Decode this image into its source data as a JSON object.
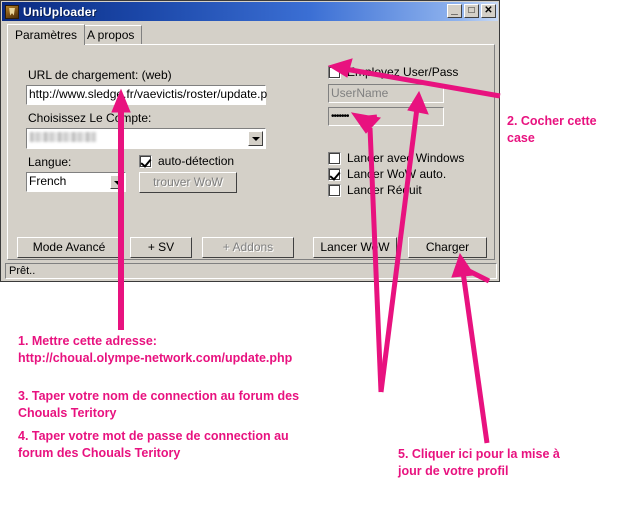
{
  "window": {
    "title": "UniUploader",
    "icon": "app-shield-icon",
    "controls": {
      "minimize": "_",
      "maximize": "□",
      "close": "✕"
    }
  },
  "tabs": [
    {
      "label": "Paramètres",
      "active": true
    },
    {
      "label": "A propos",
      "active": false
    }
  ],
  "form": {
    "url_label": "URL de chargement: (web)",
    "url_value": "http://www.sledge.fr/vaevictis/roster/update.p",
    "account_label": "Choisissez Le Compte:",
    "account_value": "",
    "lang_label": "Langue:",
    "lang_value": "French",
    "autodetect_label": "auto-détection",
    "autodetect_checked": true,
    "find_wow_label": "trouver WoW",
    "find_wow_disabled": true,
    "use_userpass_label": "Employez User/Pass",
    "use_userpass_checked": false,
    "username_placeholder": "UserName",
    "password_value": "•••••••",
    "launch_with_windows_label": "Lancer avec Windows",
    "launch_with_windows_checked": false,
    "launch_wow_auto_label": "Lancer WoW auto.",
    "launch_wow_auto_checked": true,
    "launch_reduced_label": "Lancer Réduit",
    "launch_reduced_checked": false
  },
  "buttons": {
    "advanced_mode": "Mode Avancé",
    "add_sv": "+ SV",
    "add_addons": "+ Addons",
    "add_addons_disabled": true,
    "launch_wow": "Lancer WoW",
    "charger": "Charger"
  },
  "status": {
    "text": "Prêt.."
  },
  "annotations": {
    "accent_color": "#e8127f",
    "items": [
      {
        "id": "a1",
        "text": "1. Mettre cette adresse:\nhttp://choual.olympe-network.com/update.php"
      },
      {
        "id": "a2",
        "text": "2. Cocher cette\ncase"
      },
      {
        "id": "a3",
        "text": "3. Taper votre nom de connection au forum des\nChouals Teritory"
      },
      {
        "id": "a4",
        "text": "4. Taper votre mot de passe de connection au\n   forum des Chouals Teritory"
      },
      {
        "id": "a5",
        "text": "5. Cliquer ici pour la mise à\njour de votre profil"
      }
    ]
  }
}
